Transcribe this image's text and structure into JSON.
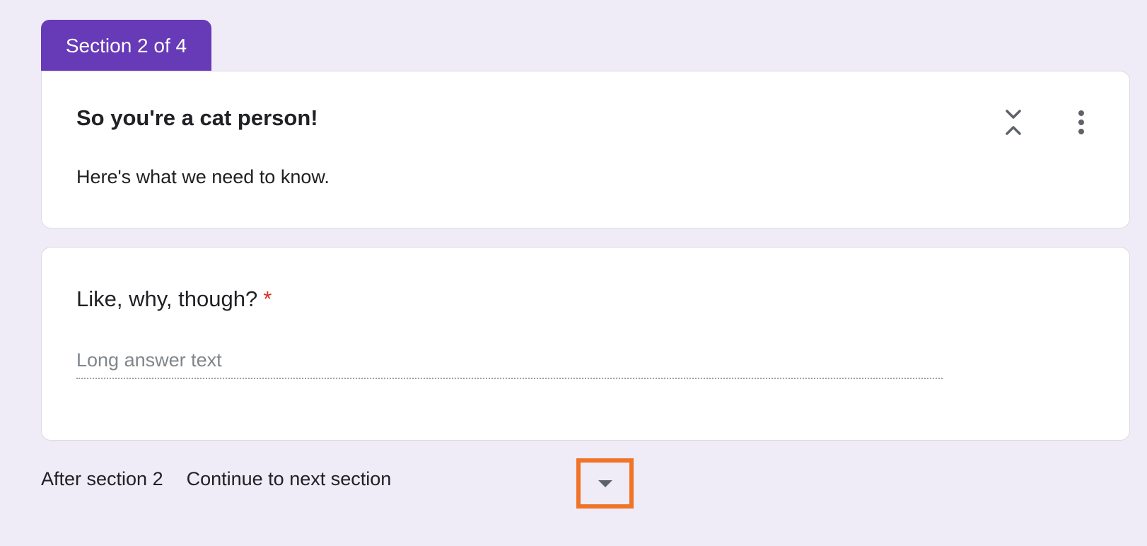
{
  "section_tab": {
    "label": "Section 2 of 4"
  },
  "section_header": {
    "title": "So you're a cat person!",
    "description": "Here's what we need to know.",
    "collapse_icon": "unfold-less-icon",
    "more_icon": "more-vert-icon"
  },
  "question": {
    "title": "Like, why, though?",
    "required_mark": "*",
    "answer_placeholder": "Long answer text"
  },
  "after_section": {
    "label": "After section 2",
    "selected_option": "Continue to next section",
    "dropdown_icon": "caret-down-icon"
  },
  "colors": {
    "accent": "#673ab7",
    "background": "#efebf7",
    "required": "#d93025",
    "highlight": "#f07428"
  }
}
